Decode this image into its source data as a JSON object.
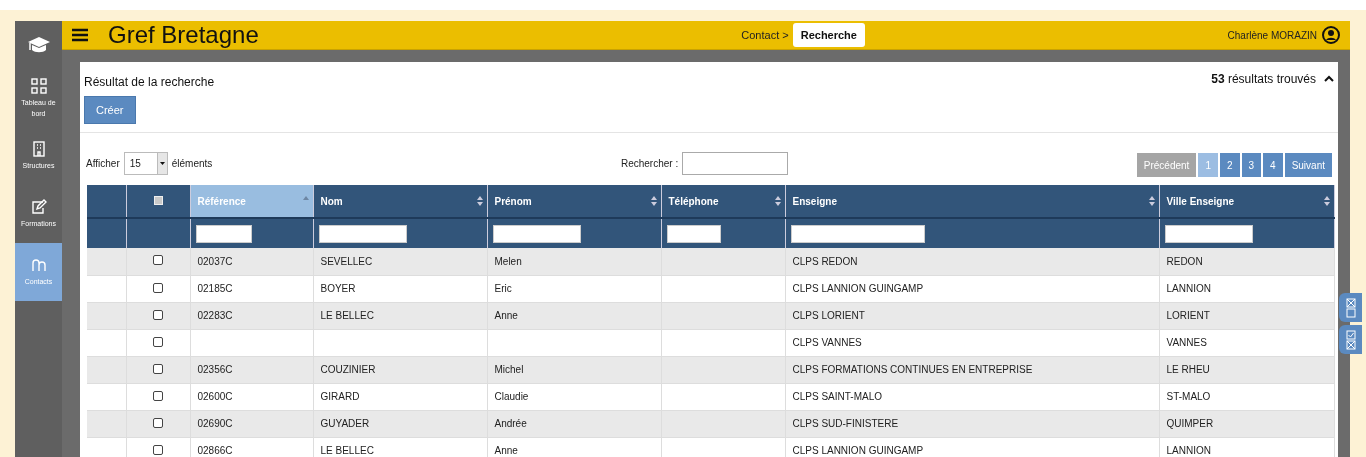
{
  "sidebar": {
    "items": [
      {
        "kind": "grid",
        "label": "Tableau de bord",
        "selected": false
      },
      {
        "kind": "building",
        "label": "Structures",
        "selected": false
      },
      {
        "kind": "edit",
        "label": "Formations",
        "selected": false
      },
      {
        "kind": "people",
        "label": "Contacts",
        "selected": true
      }
    ]
  },
  "header": {
    "title": "Gref Bretagne",
    "breadcrumb": [
      "Contact >",
      "Recherche"
    ],
    "user": "Charlène MORAZIN"
  },
  "panel": {
    "title": "Résultat de la recherche",
    "create_button": "Créer",
    "count": "53",
    "count_label": "résultats trouvés",
    "expanded": true
  },
  "controls": {
    "show_label": "Afficher",
    "page_size": "15",
    "show_suffix": "éléments",
    "search_label": "Rechercher :"
  },
  "pagination": {
    "previous": {
      "label": "Précédent",
      "disabled": true
    },
    "pages": [
      {
        "label": "1",
        "selected": true
      },
      {
        "label": "2",
        "selected": false
      },
      {
        "label": "3",
        "selected": false
      },
      {
        "label": "4",
        "selected": false
      }
    ],
    "next": {
      "label": "Suivant",
      "disabled": false
    }
  },
  "table": {
    "header_checkbox": {
      "checked": false
    },
    "columns": [
      {
        "label": "Référence",
        "sorted": true
      },
      {
        "label": "Nom",
        "sorted": false
      },
      {
        "label": "Prénom",
        "sorted": false
      },
      {
        "label": "Téléphone",
        "sorted": false
      },
      {
        "label": "Enseigne",
        "sorted": false
      },
      {
        "label": "Ville Enseigne",
        "sorted": false
      }
    ],
    "rows": [
      {
        "checked": false,
        "cells": [
          "02037C",
          "SEVELLEC",
          "Melen",
          "",
          "CLPS REDON",
          "REDON"
        ]
      },
      {
        "checked": false,
        "cells": [
          "02185C",
          "BOYER",
          "Eric",
          "",
          "CLPS LANNION GUINGAMP",
          "LANNION"
        ]
      },
      {
        "checked": false,
        "cells": [
          "02283C",
          "LE BELLEC",
          "Anne",
          "",
          "CLPS LORIENT",
          "LORIENT"
        ]
      },
      {
        "checked": false,
        "cells": [
          "",
          "",
          "",
          "",
          "CLPS VANNES",
          "VANNES"
        ]
      },
      {
        "checked": false,
        "cells": [
          "02356C",
          "COUZINIER",
          "Michel",
          "",
          "CLPS FORMATIONS CONTINUES EN ENTREPRISE",
          "LE RHEU"
        ]
      },
      {
        "checked": false,
        "cells": [
          "02600C",
          "GIRARD",
          "Claudie",
          "",
          "CLPS SAINT-MALO",
          "ST-MALO"
        ]
      },
      {
        "checked": false,
        "cells": [
          "02690C",
          "GUYADER",
          "Andrée",
          "",
          "CLPS SUD-FINISTERE",
          "QUIMPER"
        ]
      },
      {
        "checked": false,
        "cells": [
          "02866C",
          "LE BELLEC",
          "Anne",
          "",
          "CLPS LANNION GUINGAMP",
          "LANNION"
        ]
      }
    ]
  },
  "side_tools": [
    {
      "kind": "uncheck-all"
    },
    {
      "kind": "check-all"
    }
  ]
}
